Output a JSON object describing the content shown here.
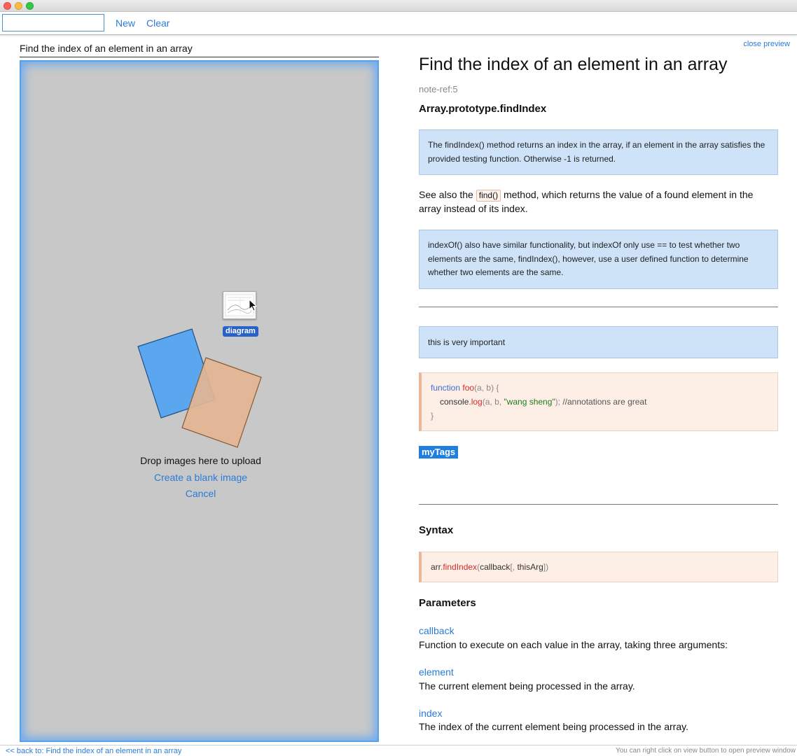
{
  "toolbar": {
    "search_value": "",
    "new_label": "New",
    "clear_label": "Clear"
  },
  "editor": {
    "title": "Find the index of an element in an array",
    "thumbnail_label": "diagram",
    "drop_text": "Drop images here to upload",
    "create_blank_label": "Create a blank image",
    "cancel_label": "Cancel"
  },
  "preview": {
    "close_label": "close preview",
    "title": "Find the index of an element in an array",
    "ref": "note-ref:5",
    "subtitle": "Array.prototype.findIndex",
    "note1": "The findIndex() method returns an index in the array, if an element in the array satisfies the provided testing function. Otherwise -1 is returned.",
    "see_also_before": "See also the ",
    "see_also_code": "find()",
    "see_also_after": " method, which returns the value of a found element in the array instead of its index.",
    "note2": "indexOf() also have similar functionality, but indexOf only use == to test whether two elements are the same, findIndex(), however, use a user defined function to determine whether two elements are the same.",
    "note3": "this is very important",
    "code": {
      "kw_function": "function",
      "fn_name": "foo",
      "args": "(a, b) {",
      "obj": "console",
      "method": ".log",
      "call_args": "(a, b, ",
      "string": "\"wang sheng\"",
      "call_end": "); ",
      "comment": "//annotations are great",
      "close": "}"
    },
    "tag": "myTags",
    "syntax_heading": "Syntax",
    "syntax": {
      "obj": "arr",
      "method": ".findIndex",
      "open": "(",
      "arg": "callback",
      "opt_open": "[, ",
      "opt_arg": "thisArg",
      "close": "])"
    },
    "parameters_heading": "Parameters",
    "params": [
      {
        "name": "callback",
        "desc": "Function to execute on each value in the array, taking three arguments:"
      },
      {
        "name": "element",
        "desc": "The current element being processed in the array."
      },
      {
        "name": "index",
        "desc": "The index of the current element being processed in the array."
      }
    ]
  },
  "footer": {
    "back_label": "<< back to: Find the index of an element in an array",
    "hint": "You can right click on view button to open preview window"
  },
  "colors": {
    "accent": "#2a7bd6",
    "note_bg": "#cfe3f8",
    "code_bg": "#fdefe6",
    "tag_bg": "#1f7fe0"
  }
}
